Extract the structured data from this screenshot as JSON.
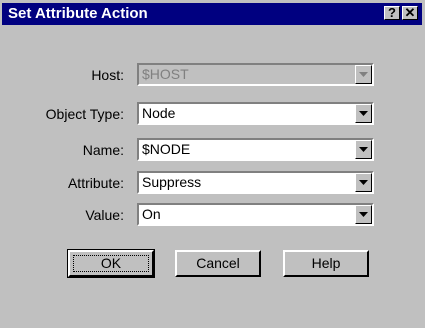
{
  "dialog": {
    "title": "Set Attribute Action",
    "help_glyph": "?",
    "close_glyph": "✕"
  },
  "fields": {
    "host": {
      "label": "Host:",
      "value": "$HOST",
      "disabled": true
    },
    "object_type": {
      "label": "Object Type:",
      "value": "Node"
    },
    "name": {
      "label": "Name:",
      "value": "$NODE"
    },
    "attribute": {
      "label": "Attribute:",
      "value": "Suppress"
    },
    "value": {
      "label": "Value:",
      "value": "On"
    }
  },
  "buttons": {
    "ok": "OK",
    "cancel": "Cancel",
    "help": "Help"
  },
  "colors": {
    "titlebar": "#000080",
    "face": "#c0c0c0"
  },
  "icons": {
    "dropdown": "chevron-down-icon",
    "help": "question-mark-icon",
    "close": "close-icon"
  }
}
